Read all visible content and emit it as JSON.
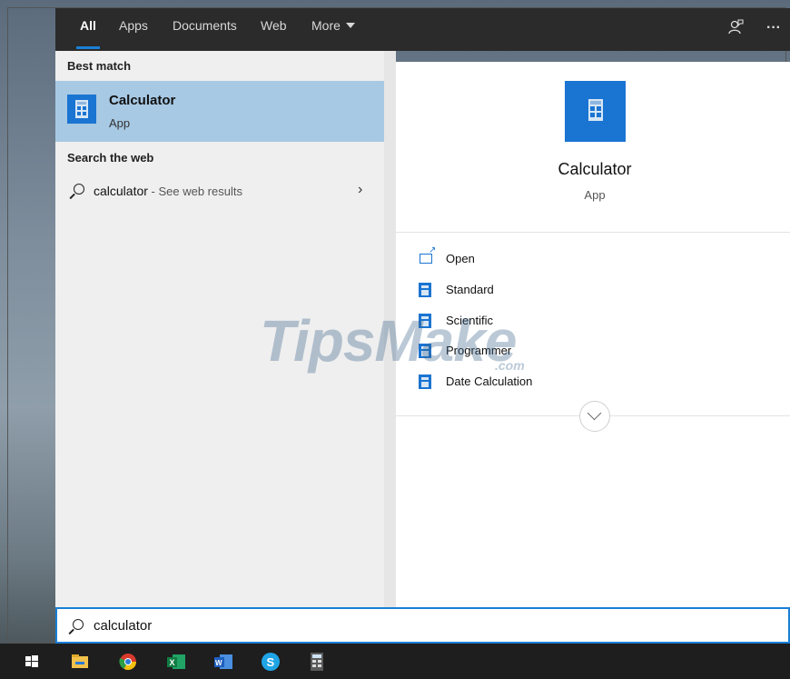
{
  "header": {
    "tabs": [
      {
        "label": "All",
        "active": true
      },
      {
        "label": "Apps"
      },
      {
        "label": "Documents"
      },
      {
        "label": "Web"
      },
      {
        "label": "More"
      }
    ],
    "feedback_icon": "feedback-icon",
    "more_options": "···"
  },
  "left": {
    "best_match_heading": "Best match",
    "best_match": {
      "title": "Calculator",
      "subtitle": "App",
      "icon": "calculator-icon"
    },
    "web_heading": "Search the web",
    "web_result": {
      "query": "calculator",
      "hint": " - See web results",
      "icon": "search-icon"
    }
  },
  "right": {
    "title": "Calculator",
    "subtitle": "App",
    "actions": [
      {
        "label": "Open",
        "icon": "open-icon"
      },
      {
        "label": "Standard",
        "icon": "calculator-icon"
      },
      {
        "label": "Scientific",
        "icon": "calculator-icon"
      },
      {
        "label": "Programmer",
        "icon": "calculator-icon"
      },
      {
        "label": "Date Calculation",
        "icon": "calculator-icon"
      }
    ]
  },
  "watermark": {
    "text": "TipsMake",
    "suffix": ".com"
  },
  "search": {
    "value": "calculator"
  },
  "taskbar": {
    "icons": [
      "start-icon",
      "file-explorer-icon",
      "chrome-icon",
      "excel-icon",
      "word-icon",
      "skype-icon",
      "calculator-icon"
    ]
  },
  "colors": {
    "accent": "#1a74d2",
    "selection": "#a7c9e4",
    "header": "#2b2b2b"
  }
}
